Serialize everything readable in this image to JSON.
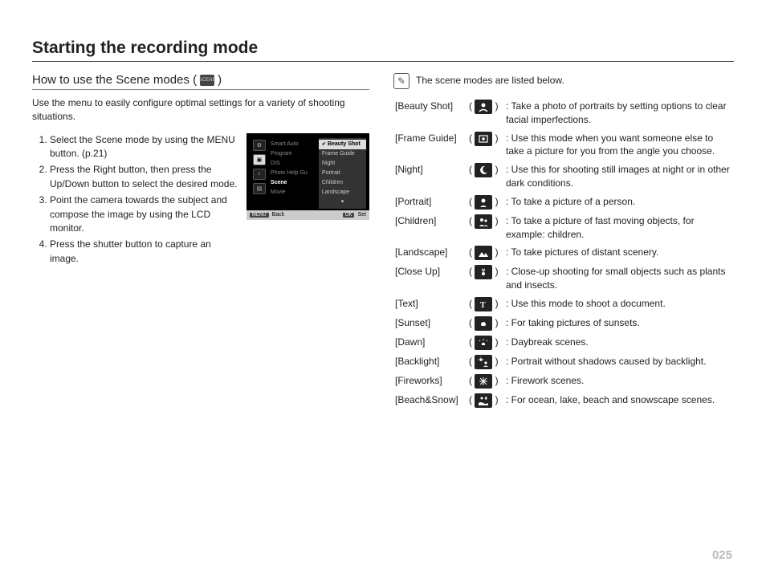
{
  "page_title": "Starting the recording mode",
  "section_title_prefix": "How to use the Scene modes (",
  "section_title_suffix": ")",
  "intro": "Use the menu to easily configure optimal settings for a variety of shooting situations.",
  "steps": [
    "Select the Scene mode by using the MENU button. (p.21)",
    "Press the Right button, then press the Up/Down button to select the desired mode.",
    "Point the camera towards the subject and compose the image by using the LCD monitor.",
    "Press the shutter button to capture an image."
  ],
  "lcd": {
    "middle": [
      "Smart Auto",
      "Program",
      "DIS",
      "Photo Help Gu",
      "Scene",
      "Movie"
    ],
    "middle_selected": "Scene",
    "right": [
      "Beauty Shot",
      "Frame Guide",
      "Night",
      "Portrait",
      "Children",
      "Landscape"
    ],
    "right_selected": "Beauty Shot",
    "arrow_down": "▾",
    "foot_back_tag": "MENU",
    "foot_back": "Back",
    "foot_set_tag": "OK",
    "foot_set": "Set"
  },
  "note": "The scene modes are listed below.",
  "scenes": [
    {
      "label": "[Beauty Shot]",
      "icon": "beauty",
      "desc": "Take a photo of portraits by setting options to clear facial imperfections."
    },
    {
      "label": "[Frame Guide]",
      "icon": "frame",
      "desc": "Use this mode when you want someone else to take a picture for you from the angle you choose."
    },
    {
      "label": "[Night]",
      "icon": "night",
      "desc": "Use this for shooting still images at night or in other dark conditions."
    },
    {
      "label": "[Portrait]",
      "icon": "portrait",
      "desc": "To take a picture of a person."
    },
    {
      "label": "[Children]",
      "icon": "children",
      "desc": "To take a picture of fast moving objects, for example: children."
    },
    {
      "label": "[Landscape]",
      "icon": "landscape",
      "desc": "To take pictures of distant scenery."
    },
    {
      "label": "[Close Up]",
      "icon": "closeup",
      "desc": "Close-up shooting for small objects such as plants and insects."
    },
    {
      "label": "[Text]",
      "icon": "text",
      "desc": "Use this mode to shoot a document."
    },
    {
      "label": "[Sunset]",
      "icon": "sunset",
      "desc": "For taking pictures of sunsets."
    },
    {
      "label": "[Dawn]",
      "icon": "dawn",
      "desc": "Daybreak scenes."
    },
    {
      "label": "[Backlight]",
      "icon": "backlight",
      "desc": "Portrait without shadows caused by backlight."
    },
    {
      "label": "[Fireworks]",
      "icon": "fireworks",
      "desc": "Firework scenes."
    },
    {
      "label": "[Beach&Snow]",
      "icon": "beach",
      "desc": "For ocean, lake, beach and snowscape scenes."
    }
  ],
  "page_number": "025"
}
